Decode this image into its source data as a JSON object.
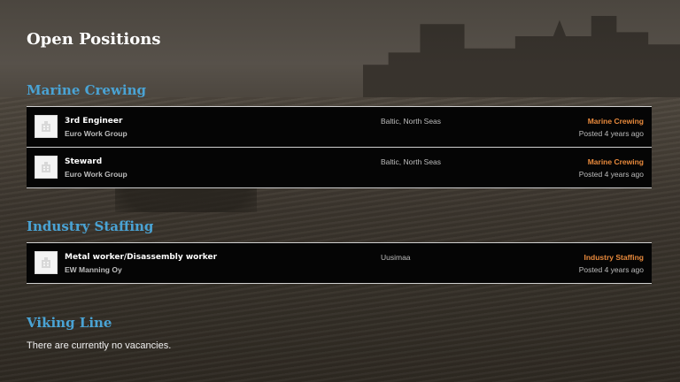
{
  "page": {
    "title": "Open Positions"
  },
  "sections": [
    {
      "title": "Marine Crewing",
      "jobs": [
        {
          "title": "3rd Engineer",
          "company": "Euro Work Group",
          "location": "Baltic, North Seas",
          "category": "Marine Crewing",
          "posted": "Posted 4 years ago"
        },
        {
          "title": "Steward",
          "company": "Euro Work Group",
          "location": "Baltic, North Seas",
          "category": "Marine Crewing",
          "posted": "Posted 4 years ago"
        }
      ]
    },
    {
      "title": "Industry Staffing",
      "jobs": [
        {
          "title": "Metal worker/Disassembly worker",
          "company": "EW Manning Oy",
          "location": "Uusimaa",
          "category": "Industry Staffing",
          "posted": "Posted 4 years ago"
        }
      ]
    },
    {
      "title": "Viking Line",
      "empty_message": "There are currently no vacancies."
    }
  ],
  "icons": {
    "company_logo": "company-building-icon"
  },
  "colors": {
    "section_title": "#4aa3d4",
    "category": "#e98a3c",
    "row_bg": "#050505"
  }
}
